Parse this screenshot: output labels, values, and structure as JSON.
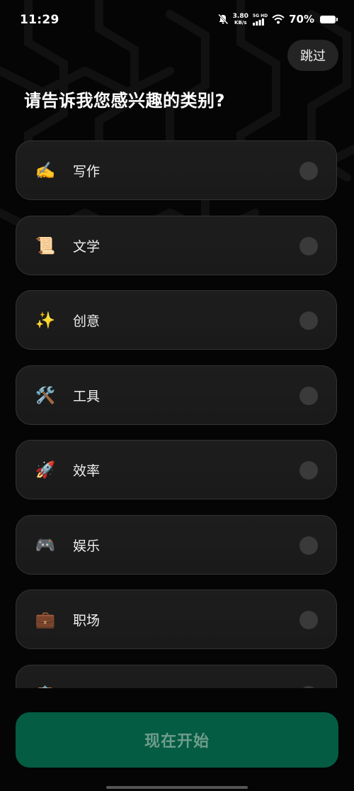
{
  "status_bar": {
    "time": "11:29",
    "net_speed_value": "3.80",
    "net_speed_unit": "KB/s",
    "signal_label_top": "5G HD",
    "battery": "70%"
  },
  "skip_label": "跳过",
  "title": "请告诉我您感兴趣的类别?",
  "categories": [
    {
      "icon": "✍️",
      "label": "写作"
    },
    {
      "icon": "📜",
      "label": "文学"
    },
    {
      "icon": "✨",
      "label": "创意"
    },
    {
      "icon": "🛠️",
      "label": "工具"
    },
    {
      "icon": "🚀",
      "label": "效率"
    },
    {
      "icon": "🎮",
      "label": "娱乐"
    },
    {
      "icon": "💼",
      "label": "职场"
    },
    {
      "icon": "📋",
      "label": ""
    }
  ],
  "start_label": "现在开始",
  "colors": {
    "background": "#000000",
    "card": "#1c1c1c",
    "accent_button": "#045c42",
    "accent_button_text": "#6f9c8b"
  }
}
